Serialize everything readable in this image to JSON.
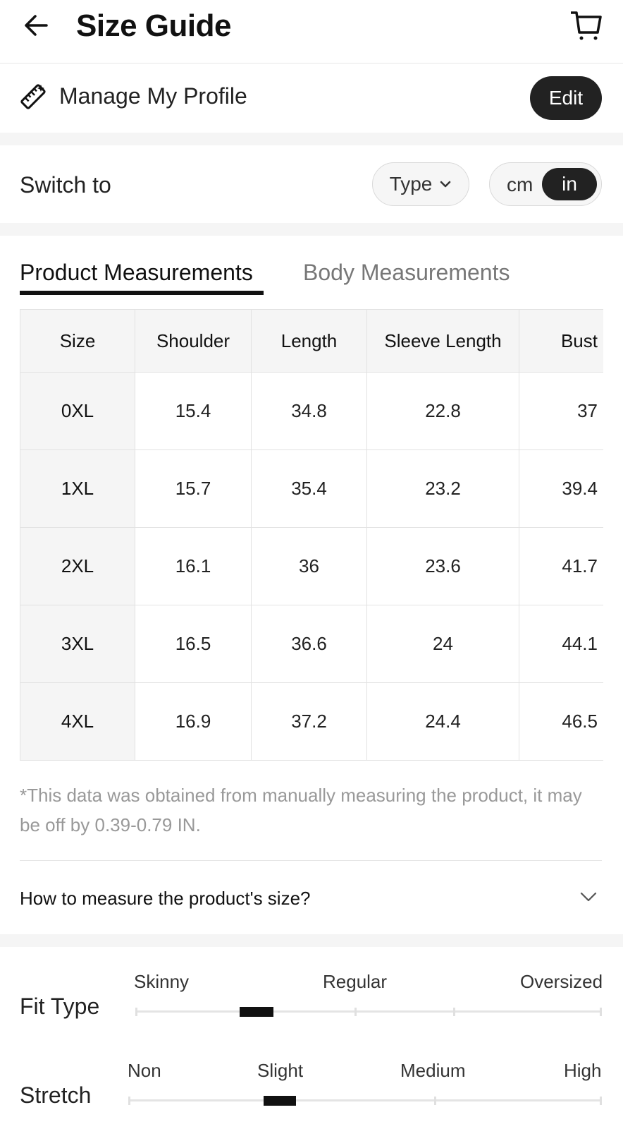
{
  "header": {
    "title": "Size Guide",
    "back_icon": "arrow-left-icon",
    "cart_icon": "cart-icon"
  },
  "profile": {
    "icon": "ruler-icon",
    "label": "Manage My Profile",
    "edit_label": "Edit"
  },
  "switch": {
    "label": "Switch to",
    "type_label": "Type",
    "unit_options": [
      "cm",
      "in"
    ],
    "selected_unit": "in"
  },
  "tabs": [
    {
      "label": "Product Measurements",
      "active": true
    },
    {
      "label": "Body Measurements",
      "active": false
    }
  ],
  "table": {
    "headers": [
      "Size",
      "Shoulder",
      "Length",
      "Sleeve Length",
      "Bust"
    ],
    "rows": [
      [
        "0XL",
        "15.4",
        "34.8",
        "22.8",
        "37"
      ],
      [
        "1XL",
        "15.7",
        "35.4",
        "23.2",
        "39.4"
      ],
      [
        "2XL",
        "16.1",
        "36",
        "23.6",
        "41.7"
      ],
      [
        "3XL",
        "16.5",
        "36.6",
        "24",
        "44.1"
      ],
      [
        "4XL",
        "16.9",
        "37.2",
        "24.4",
        "46.5"
      ]
    ]
  },
  "note": "*This data was obtained from manually measuring the product, it may be off by 0.39-0.79 IN.",
  "howto": {
    "label": "How to measure the product's size?",
    "icon": "chevron-down-icon"
  },
  "fit_type": {
    "title": "Fit Type",
    "labels": [
      "Skinny",
      "Regular",
      "Oversized"
    ],
    "level": 0.26
  },
  "stretch": {
    "title": "Stretch",
    "labels": [
      "Non",
      "Slight",
      "Medium",
      "High"
    ],
    "level": 0.32
  },
  "colors": {
    "accent": "#222222",
    "section_gap": "#f5f5f5",
    "muted_text": "#999999"
  }
}
